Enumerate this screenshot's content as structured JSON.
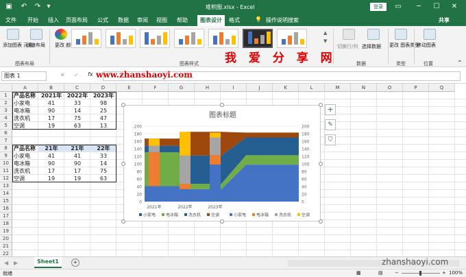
{
  "window": {
    "title": "堆积图.xlsx - Excel",
    "login": "登录",
    "share": "共享"
  },
  "tabs": [
    "文件",
    "开始",
    "插入",
    "页面布局",
    "公式",
    "数据",
    "审阅",
    "视图",
    "帮助",
    "图表设计",
    "格式"
  ],
  "active_tab": "图表设计",
  "tell_me": "操作说明搜索",
  "ribbon": {
    "add_element": "添加图表\n元素",
    "quick_layout": "快速布局",
    "change_color": "更改\n颜色",
    "group_layout": "图表布局",
    "group_styles": "图表样式",
    "switch_rowcol": "切换行/列",
    "select_data": "选择数据",
    "group_data": "数据",
    "change_type": "更改\n图表类型",
    "group_type": "类型",
    "move_chart": "移动图表",
    "group_location": "位置"
  },
  "formula_bar": {
    "name_box": "图表 1",
    "fx": "fx",
    "cancel": "✕",
    "confirm": "✓"
  },
  "columns": [
    "A",
    "B",
    "C",
    "D",
    "E",
    "F",
    "G",
    "H",
    "I",
    "J",
    "K",
    "L",
    "M",
    "N",
    "O",
    "P",
    "Q"
  ],
  "rows": [
    "1",
    "2",
    "3",
    "4",
    "5",
    "6",
    "7",
    "8",
    "9",
    "10",
    "11",
    "12",
    "13",
    "14",
    "15",
    "16",
    "17",
    "18",
    "19",
    "20",
    "21",
    "22"
  ],
  "table1": {
    "header": [
      "产品名称",
      "2021年",
      "2022年",
      "2023年"
    ],
    "rows": [
      [
        "小家电",
        "41",
        "33",
        "98"
      ],
      [
        "电冰箱",
        "90",
        "14",
        "25"
      ],
      [
        "洗衣机",
        "17",
        "75",
        "47"
      ],
      [
        "空调",
        "19",
        "63",
        "13"
      ]
    ]
  },
  "table2": {
    "header": [
      "产品名称",
      "21年",
      "21年",
      "22年"
    ],
    "rows": [
      [
        "小家电",
        "41",
        "41",
        "33"
      ],
      [
        "电冰箱",
        "90",
        "90",
        "14"
      ],
      [
        "洗衣机",
        "17",
        "17",
        "75"
      ],
      [
        "空调",
        "19",
        "19",
        "63"
      ]
    ]
  },
  "chart_data": {
    "type": "bar",
    "title": "图表标题",
    "categories": [
      "2021年",
      "2022年",
      "2023年"
    ],
    "series": [
      {
        "name": "小家电",
        "values": [
          41,
          33,
          98
        ],
        "color": "#4472c4"
      },
      {
        "name": "电冰箱",
        "values": [
          90,
          14,
          25
        ],
        "color": "#ed7d31"
      },
      {
        "name": "洗衣机",
        "values": [
          17,
          75,
          47
        ],
        "color": "#a5a5a5"
      },
      {
        "name": "空调",
        "values": [
          19,
          63,
          13
        ],
        "color": "#ffc000"
      }
    ],
    "area_series": [
      {
        "name": "小家电",
        "values": [
          41,
          41,
          33,
          33,
          98,
          98
        ],
        "color": "#4472c4"
      },
      {
        "name": "电冰箱",
        "values": [
          90,
          90,
          14,
          14,
          25,
          25
        ],
        "color": "#70ad47"
      },
      {
        "name": "洗衣机",
        "values": [
          17,
          17,
          75,
          75,
          47,
          47
        ],
        "color": "#255e91"
      },
      {
        "name": "空调",
        "values": [
          19,
          19,
          63,
          63,
          13,
          13
        ],
        "color": "#9e480e"
      }
    ],
    "legend": [
      "小家电",
      "电冰箱",
      "洗衣机",
      "空调",
      "小家电",
      "电冰箱",
      "洗衣机",
      "空调"
    ],
    "legend_colors": [
      "#255e91",
      "#70ad47",
      "#255e91",
      "#9e480e",
      "#4472c4",
      "#ed7d31",
      "#a5a5a5",
      "#ffc000"
    ],
    "y_ticks": [
      "0",
      "20",
      "40",
      "60",
      "80",
      "100",
      "120",
      "140",
      "160",
      "180",
      "200"
    ],
    "ylim": [
      0,
      200
    ],
    "legend_position": "bottom"
  },
  "sheet": {
    "tab": "Sheet1",
    "add": "+"
  },
  "status": {
    "ready": "就绪",
    "zoom": "100%"
  },
  "watermarks": {
    "w1": "我 爱 分 享 网",
    "w2": "www.zhanshaoyi.com",
    "w3": "zhanshaoyi.com"
  }
}
